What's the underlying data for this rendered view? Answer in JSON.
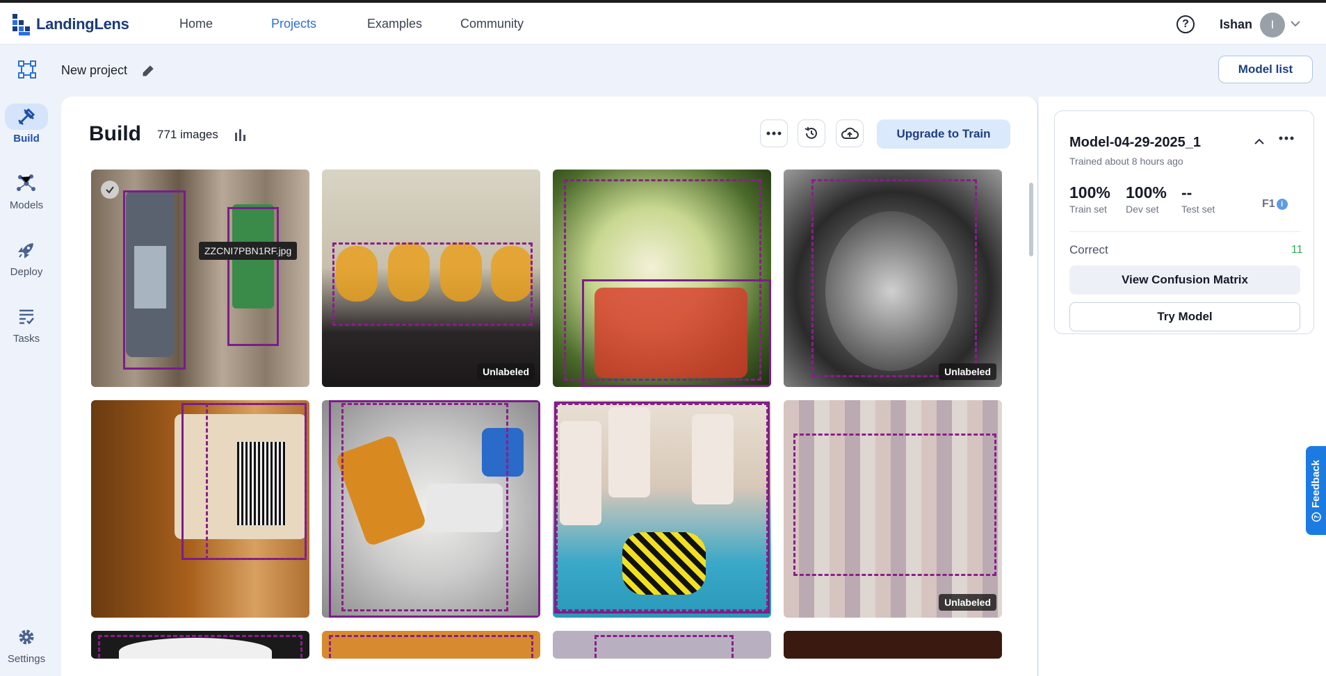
{
  "app": {
    "logo_text": "LandingLens"
  },
  "nav": {
    "items": [
      "Home",
      "Projects",
      "Examples",
      "Community"
    ],
    "active": "Projects",
    "user_name": "Ishan",
    "avatar_initial": "I"
  },
  "sidebar": {
    "items": [
      {
        "label": "Build",
        "icon": "build-tools-icon"
      },
      {
        "label": "Models",
        "icon": "models-network-icon"
      },
      {
        "label": "Deploy",
        "icon": "rocket-icon"
      },
      {
        "label": "Tasks",
        "icon": "tasks-checklist-icon"
      }
    ],
    "settings_label": "Settings"
  },
  "project": {
    "title": "New project",
    "model_list_label": "Model list"
  },
  "build": {
    "title": "Build",
    "image_count": "771 images",
    "upgrade_label": "Upgrade to Train",
    "tooltip_filename": "ZZCNI7PBN1RF.jpg",
    "unlabeled_label": "Unlabeled"
  },
  "model": {
    "name": "Model-04-29-2025_1",
    "trained": "Trained about 8 hours ago",
    "metrics": [
      {
        "value": "100%",
        "label": "Train set"
      },
      {
        "value": "100%",
        "label": "Dev set"
      },
      {
        "value": "--",
        "label": "Test set"
      }
    ],
    "metric_type": "F1",
    "correct_label": "Correct",
    "correct_value": "11",
    "confusion_label": "View Confusion Matrix",
    "try_label": "Try Model"
  },
  "feedback_label": "Feedback",
  "colors": {
    "accent": "#2a6fdb",
    "bbox": "#8a1e8a",
    "correct": "#2eaa5a",
    "feedback": "#1c7be0"
  }
}
